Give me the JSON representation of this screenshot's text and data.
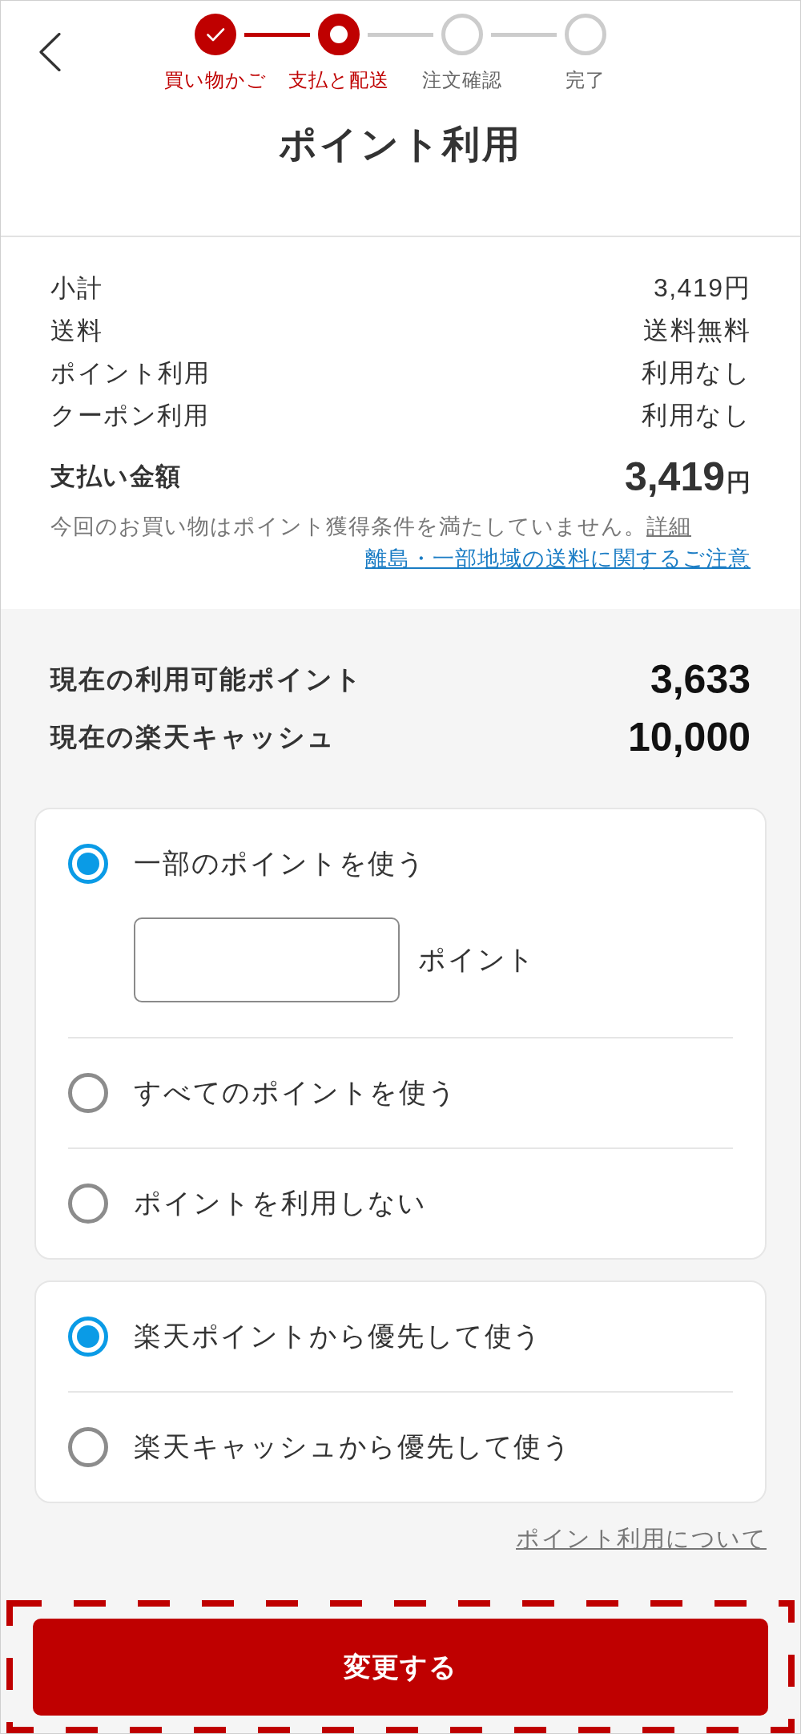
{
  "header": {
    "steps": [
      {
        "label": "買い物かご",
        "kind": "completed"
      },
      {
        "label": "支払と配送",
        "kind": "current"
      },
      {
        "label": "注文確認",
        "kind": "pending"
      },
      {
        "label": "完了",
        "kind": "pending"
      }
    ],
    "title": "ポイント利用"
  },
  "summary": {
    "rows": [
      {
        "label": "小計",
        "value": "3,419円"
      },
      {
        "label": "送料",
        "value": "送料無料"
      },
      {
        "label": "ポイント利用",
        "value": "利用なし"
      },
      {
        "label": "クーポン利用",
        "value": "利用なし"
      }
    ],
    "total": {
      "label": "支払い金額",
      "amount": "3,419",
      "unit": "円"
    },
    "note": "今回のお買い物はポイント獲得条件を満たしていません。",
    "note_link": "詳細",
    "shipping_link": "離島・一部地域の送料に関するご注意"
  },
  "balances": [
    {
      "label": "現在の利用可能ポイント",
      "value": "3,633"
    },
    {
      "label": "現在の楽天キャッシュ",
      "value": "10,000"
    }
  ],
  "point_options": [
    {
      "label": "一部のポイントを使う",
      "selected": true,
      "kind": "amount",
      "unit": "ポイント"
    },
    {
      "label": "すべてのポイントを使う",
      "selected": false,
      "kind": "plain"
    },
    {
      "label": "ポイントを利用しない",
      "selected": false,
      "kind": "plain"
    }
  ],
  "priority_options": [
    {
      "label": "楽天ポイントから優先して使う",
      "selected": true
    },
    {
      "label": "楽天キャッシュから優先して使う",
      "selected": false
    }
  ],
  "help_link": "ポイント利用について",
  "submit_button": {
    "label": "変更する",
    "highlighted": true
  }
}
